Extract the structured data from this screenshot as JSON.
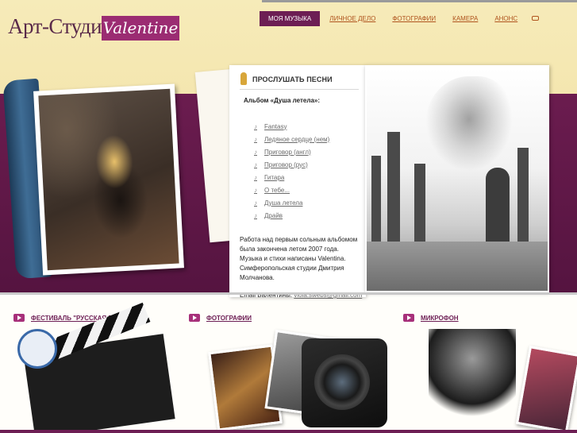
{
  "logo": {
    "text": "Арт-Студия",
    "badge": "Valentine"
  },
  "nav": [
    {
      "label": "Моя музыка",
      "active": true
    },
    {
      "label": "Личное дело",
      "active": false
    },
    {
      "label": "Фотографии",
      "active": false
    },
    {
      "label": "Камера",
      "active": false
    },
    {
      "label": "Анонс",
      "active": false
    }
  ],
  "listen": {
    "title": "ПРОСЛУШАТЬ ПЕСНИ",
    "album": "Альбом «Душа летела»:",
    "songs": [
      "Fantasy",
      "Ледяное сердце (нем)",
      "Приговор (англ)",
      "Приговор (рус)",
      "Гитара",
      "О тебе...",
      "Душа летела",
      "Драйв"
    ],
    "description": "Работа над первым сольным альбомом была закончена летом 2007 года. Музыка и стихи написаны Valentina. Симферопольская студии Дмитрия Молчанова.",
    "email_label": "Email Валентины:",
    "email": "viola.swebs@gmail.com"
  },
  "sections": [
    {
      "label": "Фестиваль \"Русская песня\""
    },
    {
      "label": "Фотографии"
    },
    {
      "label": "Микрофон"
    }
  ],
  "colors": {
    "accent": "#6d1e54",
    "badge": "#9b2c72",
    "link": "#b0541e",
    "band": "#5e1646"
  },
  "icons": {
    "mic": "microphone-icon",
    "note": "music-note-icon",
    "arrow": "arrow-right-icon",
    "mail": "envelope-icon"
  }
}
